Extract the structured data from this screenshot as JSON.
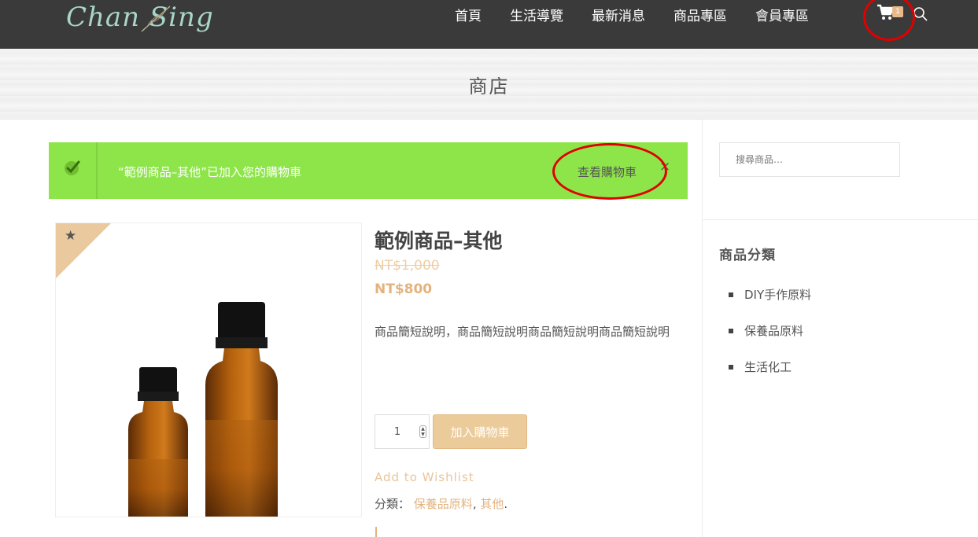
{
  "header": {
    "logo_text": "Chan Sing",
    "nav": [
      {
        "label": "首頁"
      },
      {
        "label": "生活導覽"
      },
      {
        "label": "最新消息"
      },
      {
        "label": "商品專區"
      },
      {
        "label": "會員專區"
      }
    ],
    "cart_count": "1",
    "icons": [
      "cart-icon",
      "search-icon"
    ]
  },
  "banner": {
    "title": "商店"
  },
  "notice": {
    "message": "“範例商品–其他”已加入您的購物車",
    "link_label": "查看購物車",
    "close_label": "×",
    "icon": "check-icon",
    "color": "#8ee54a"
  },
  "product": {
    "ribbon_icon": "★",
    "title": "範例商品–其他",
    "old_price": "NT$1,000",
    "new_price": "NT$800",
    "description": "商品簡短說明，商品簡短說明商品簡短說明商品簡短說明",
    "quantity": "1",
    "add_to_cart_label": "加入購物車",
    "wishlist_label": "Add to Wishlist",
    "categories_label": "分類：",
    "categories": [
      "保養品原料",
      "其他"
    ],
    "category_separator": ",",
    "category_end": "."
  },
  "sidebar": {
    "search_placeholder": "搜尋商品…",
    "category_heading": "商品分類",
    "categories": [
      {
        "label": "DIY手作原料"
      },
      {
        "label": "保養品原料"
      },
      {
        "label": "生活化工"
      }
    ]
  },
  "colors": {
    "accent": "#e3b37e",
    "header_bg": "#3a3a3a",
    "highlight_ring": "#e00000"
  }
}
